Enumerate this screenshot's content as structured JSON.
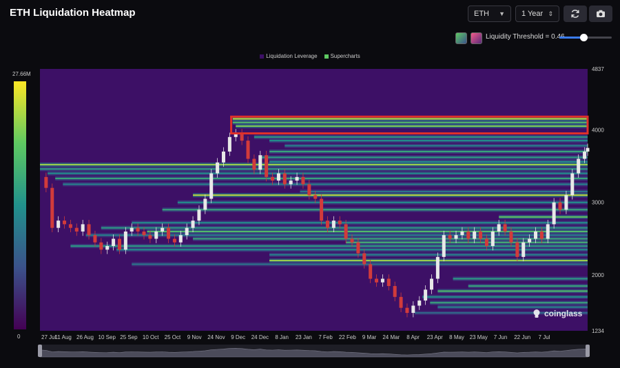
{
  "header": {
    "title": "ETH Liquidation Heatmap",
    "symbol_select": "ETH",
    "period_select": "1 Year",
    "threshold_label": "Liquidity Threshold = 0.46",
    "threshold_value": 0.46
  },
  "colors": {
    "background": "#0b0b0f",
    "heat_base": "#3d1066",
    "highlight": "#e0302a",
    "candle_up": "#e8e8e8",
    "candle_down": "#d13b3b"
  },
  "watermark": "coinglass",
  "colorbar": {
    "max_label": "27.66M",
    "min_label": "0"
  },
  "chart_data": {
    "type": "heatmap",
    "legend": [
      "Liquidation Leverage",
      "Supercharts"
    ],
    "legend_colors": [
      "#3d1066",
      "#5ec962"
    ],
    "xticks": [
      "27 Jul",
      "11 Aug",
      "26 Aug",
      "10 Sep",
      "25 Sep",
      "10 Oct",
      "25 Oct",
      "9 Nov",
      "24 Nov",
      "9 Dec",
      "24 Dec",
      "8 Jan",
      "23 Jan",
      "7 Feb",
      "22 Feb",
      "9 Mar",
      "24 Mar",
      "8 Apr",
      "23 Apr",
      "8 May",
      "23 May",
      "7 Jun",
      "22 Jun",
      "7 Jul"
    ],
    "yticks": [
      1234,
      2000,
      3000,
      4000,
      4837
    ],
    "ylim": [
      1234,
      4837
    ],
    "x_range_days": [
      0,
      358
    ],
    "price_path": [
      [
        0,
        3350
      ],
      [
        4,
        3200
      ],
      [
        8,
        2650
      ],
      [
        12,
        2750
      ],
      [
        16,
        2700
      ],
      [
        20,
        2650
      ],
      [
        24,
        2600
      ],
      [
        28,
        2700
      ],
      [
        32,
        2550
      ],
      [
        36,
        2450
      ],
      [
        40,
        2350
      ],
      [
        44,
        2400
      ],
      [
        48,
        2500
      ],
      [
        52,
        2350
      ],
      [
        56,
        2600
      ],
      [
        60,
        2650
      ],
      [
        64,
        2600
      ],
      [
        68,
        2550
      ],
      [
        72,
        2500
      ],
      [
        76,
        2600
      ],
      [
        80,
        2650
      ],
      [
        84,
        2500
      ],
      [
        88,
        2450
      ],
      [
        92,
        2550
      ],
      [
        96,
        2650
      ],
      [
        100,
        2750
      ],
      [
        104,
        2900
      ],
      [
        108,
        3050
      ],
      [
        112,
        3400
      ],
      [
        116,
        3550
      ],
      [
        120,
        3700
      ],
      [
        124,
        3900
      ],
      [
        128,
        3950
      ],
      [
        132,
        3850
      ],
      [
        136,
        3600
      ],
      [
        140,
        3450
      ],
      [
        144,
        3650
      ],
      [
        148,
        3350
      ],
      [
        152,
        3300
      ],
      [
        156,
        3400
      ],
      [
        160,
        3250
      ],
      [
        164,
        3300
      ],
      [
        168,
        3350
      ],
      [
        172,
        3250
      ],
      [
        176,
        3100
      ],
      [
        180,
        3050
      ],
      [
        184,
        2750
      ],
      [
        188,
        2650
      ],
      [
        192,
        2750
      ],
      [
        196,
        2700
      ],
      [
        200,
        2500
      ],
      [
        204,
        2450
      ],
      [
        208,
        2300
      ],
      [
        212,
        2150
      ],
      [
        216,
        1950
      ],
      [
        220,
        1900
      ],
      [
        224,
        1950
      ],
      [
        228,
        1850
      ],
      [
        232,
        1700
      ],
      [
        236,
        1550
      ],
      [
        240,
        1480
      ],
      [
        244,
        1580
      ],
      [
        248,
        1650
      ],
      [
        252,
        1800
      ],
      [
        256,
        1950
      ],
      [
        260,
        2250
      ],
      [
        264,
        2550
      ],
      [
        268,
        2500
      ],
      [
        272,
        2550
      ],
      [
        276,
        2600
      ],
      [
        280,
        2500
      ],
      [
        284,
        2600
      ],
      [
        288,
        2500
      ],
      [
        292,
        2400
      ],
      [
        296,
        2600
      ],
      [
        300,
        2700
      ],
      [
        304,
        2600
      ],
      [
        308,
        2450
      ],
      [
        312,
        2250
      ],
      [
        316,
        2450
      ],
      [
        320,
        2500
      ],
      [
        324,
        2600
      ],
      [
        328,
        2500
      ],
      [
        332,
        2700
      ],
      [
        336,
        3000
      ],
      [
        340,
        2900
      ],
      [
        344,
        3100
      ],
      [
        348,
        3400
      ],
      [
        352,
        3600
      ],
      [
        356,
        3700
      ],
      [
        358,
        3750
      ]
    ],
    "liquidity_bands": [
      {
        "price": 4150,
        "start": 126,
        "intensity": 0.9
      },
      {
        "price": 4100,
        "start": 126,
        "intensity": 0.7
      },
      {
        "price": 4050,
        "start": 128,
        "intensity": 0.8
      },
      {
        "price": 3900,
        "start": 140,
        "intensity": 0.55
      },
      {
        "price": 3850,
        "start": 150,
        "intensity": 0.5
      },
      {
        "price": 3780,
        "start": 160,
        "intensity": 0.45
      },
      {
        "price": 3700,
        "start": 150,
        "intensity": 0.6
      },
      {
        "price": 3620,
        "start": 145,
        "intensity": 0.55
      },
      {
        "price": 3560,
        "start": 150,
        "intensity": 0.5
      },
      {
        "price": 3520,
        "start": 0,
        "intensity": 0.85
      },
      {
        "price": 3460,
        "start": 0,
        "intensity": 0.55
      },
      {
        "price": 3400,
        "start": 5,
        "intensity": 0.5
      },
      {
        "price": 3330,
        "start": 10,
        "intensity": 0.6
      },
      {
        "price": 3250,
        "start": 15,
        "intensity": 0.45
      },
      {
        "price": 3150,
        "start": 170,
        "intensity": 0.4
      },
      {
        "price": 3100,
        "start": 100,
        "intensity": 0.9
      },
      {
        "price": 3000,
        "start": 90,
        "intensity": 0.5
      },
      {
        "price": 2900,
        "start": 80,
        "intensity": 0.6
      },
      {
        "price": 2800,
        "start": 300,
        "intensity": 0.75
      },
      {
        "price": 2720,
        "start": 60,
        "intensity": 0.5
      },
      {
        "price": 2650,
        "start": 40,
        "intensity": 0.55
      },
      {
        "price": 2600,
        "start": 70,
        "intensity": 0.7
      },
      {
        "price": 2550,
        "start": 30,
        "intensity": 0.45
      },
      {
        "price": 2500,
        "start": 100,
        "intensity": 0.6
      },
      {
        "price": 2450,
        "start": 200,
        "intensity": 0.65
      },
      {
        "price": 2400,
        "start": 20,
        "intensity": 0.55
      },
      {
        "price": 2350,
        "start": 50,
        "intensity": 0.5
      },
      {
        "price": 2280,
        "start": 150,
        "intensity": 0.45
      },
      {
        "price": 2200,
        "start": 150,
        "intensity": 0.85
      },
      {
        "price": 2150,
        "start": 60,
        "intensity": 0.4
      },
      {
        "price": 1950,
        "start": 270,
        "intensity": 0.55
      },
      {
        "price": 1850,
        "start": 280,
        "intensity": 0.6
      },
      {
        "price": 1780,
        "start": 260,
        "intensity": 0.7
      },
      {
        "price": 1700,
        "start": 250,
        "intensity": 0.5
      },
      {
        "price": 1620,
        "start": 255,
        "intensity": 0.6
      },
      {
        "price": 1560,
        "start": 260,
        "intensity": 0.45
      },
      {
        "price": 1480,
        "start": 245,
        "intensity": 0.35
      }
    ],
    "highlight_box": {
      "price_low": 3950,
      "price_high": 4180,
      "start": 125
    }
  }
}
